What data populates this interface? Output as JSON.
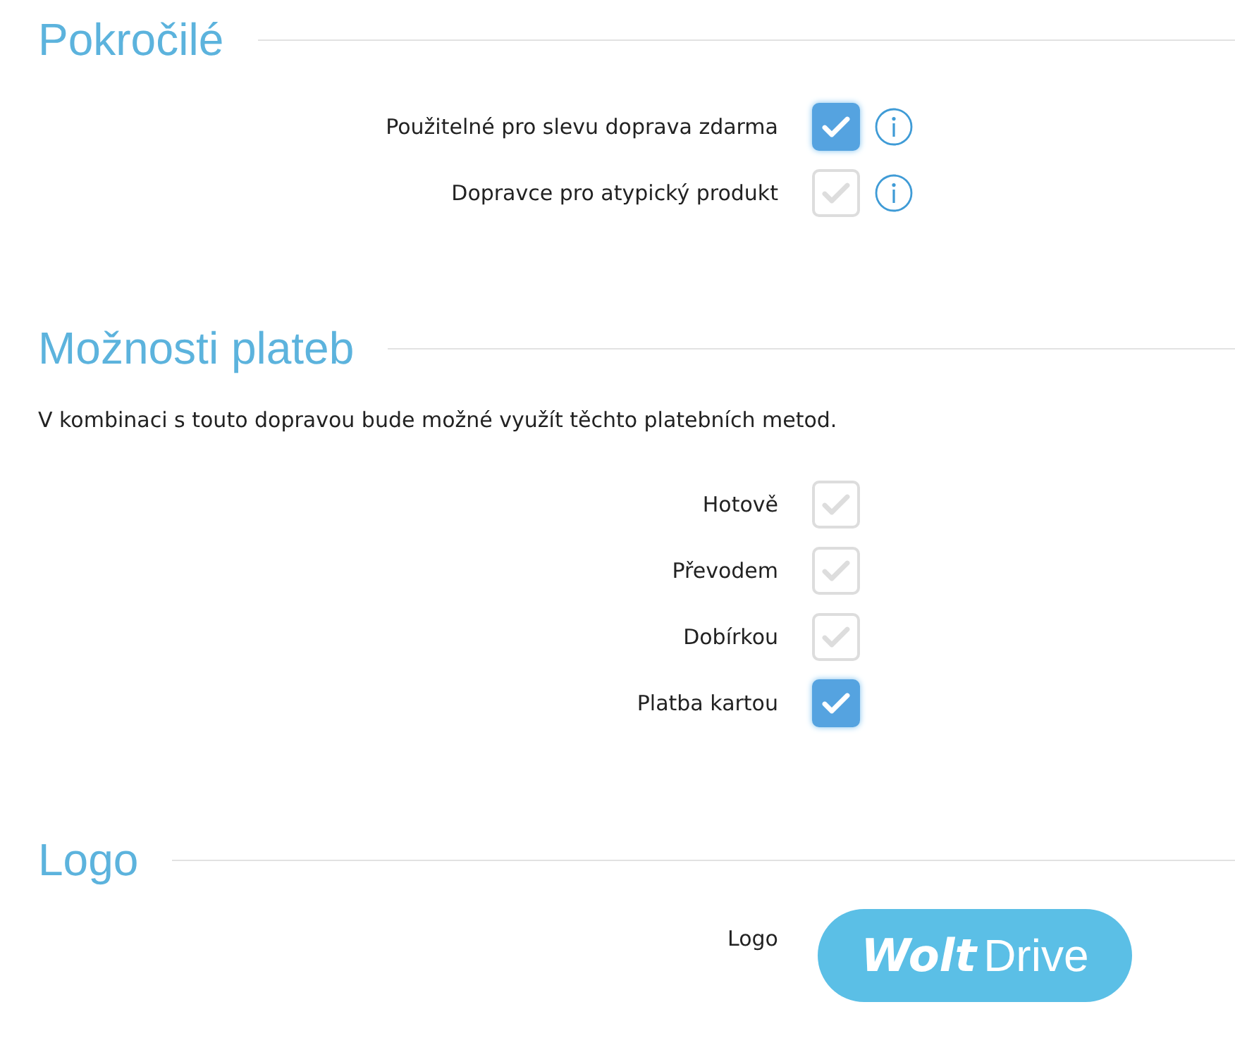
{
  "sections": [
    {
      "kind": "options",
      "title": "Pokročilé",
      "rows": [
        {
          "label": "Použitelné pro slevu doprava zdarma",
          "checked": true,
          "info": true
        },
        {
          "label": "Dopravce pro atypický produkt",
          "checked": false,
          "info": true
        }
      ]
    },
    {
      "kind": "options",
      "title": "Možnosti plateb",
      "description": "V kombinaci s touto dopravou bude možné využít těchto platebních metod.",
      "rows": [
        {
          "label": "Hotově",
          "checked": false,
          "info": false
        },
        {
          "label": "Převodem",
          "checked": false,
          "info": false
        },
        {
          "label": "Dobírkou",
          "checked": false,
          "info": false
        },
        {
          "label": "Platba kartou",
          "checked": true,
          "info": false
        }
      ]
    },
    {
      "kind": "logo",
      "title": "Logo",
      "label": "Logo",
      "logo": {
        "bold": "Wolt",
        "light": "Drive"
      }
    }
  ]
}
